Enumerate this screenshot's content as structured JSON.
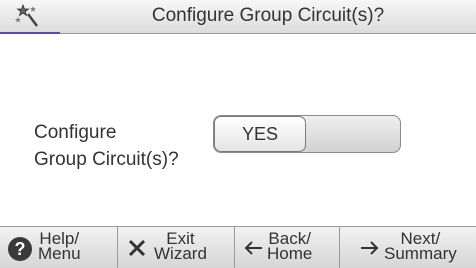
{
  "header": {
    "title": "Configure Group Circuit(s)?",
    "icon": "wizard-wand-icon"
  },
  "main": {
    "question_line1": "Configure",
    "question_line2": "Group Circuit(s)?",
    "toggle": {
      "selected_label": "YES",
      "selected": "YES"
    }
  },
  "footer": {
    "help": {
      "line1": "Help/",
      "line2": "Menu",
      "icon": "help-icon"
    },
    "exit": {
      "line1": "Exit",
      "line2": "Wizard",
      "icon": "close-icon"
    },
    "back": {
      "line1": "Back/",
      "line2": "Home",
      "icon": "arrow-left-icon"
    },
    "next": {
      "line1": "Next/",
      "line2": "Summary",
      "icon": "arrow-right-icon"
    }
  },
  "colors": {
    "accent_underline": "#5a4aa8"
  }
}
